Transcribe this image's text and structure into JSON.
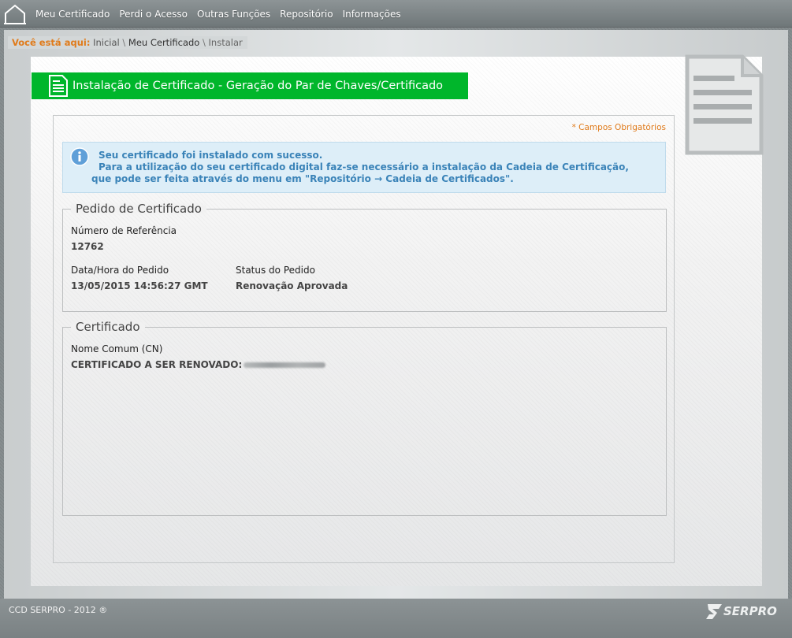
{
  "nav": {
    "items": [
      {
        "label": "Meu Certificado"
      },
      {
        "label": "Perdi o Acesso"
      },
      {
        "label": "Outras Funções"
      },
      {
        "label": "Repositório"
      },
      {
        "label": "Informações"
      }
    ]
  },
  "breadcrumb": {
    "label": "Você está aqui:",
    "items": [
      "Inicial",
      "Meu Certificado",
      "Instalar"
    ],
    "separator": "\\"
  },
  "page": {
    "title": "Instalação de Certificado - Geração do Par de Chaves/Certificado",
    "required_note": "* Campos Obrigatórios"
  },
  "info": {
    "line1": "Seu certificado foi instalado com sucesso.",
    "line2": "Para a utilização do seu certificado digital faz-se necessário a instalação da Cadeia de Certificação,",
    "line3": "que pode ser feita através do menu em \"Repositório → Cadeia de Certificados\"."
  },
  "pedido": {
    "legend": "Pedido de Certificado",
    "ref_label": "Número de Referência",
    "ref_value": "12762",
    "date_label": "Data/Hora do Pedido",
    "date_value": "13/05/2015 14:56:27 GMT",
    "status_label": "Status do Pedido",
    "status_value": "Renovação Aprovada"
  },
  "certificado": {
    "legend": "Certificado",
    "cn_label": "Nome Comum (CN)",
    "cn_value": "CERTIFICADO A SER RENOVADO:"
  },
  "footer": {
    "copyright": "CCD SERPRO - 2012 ®",
    "logo_text": "SERPRO"
  },
  "colors": {
    "accent_green": "#00b62b",
    "breadcrumb_orange": "#e07b1b",
    "info_blue": "#3a83b8",
    "info_bg": "#ddeef8"
  }
}
